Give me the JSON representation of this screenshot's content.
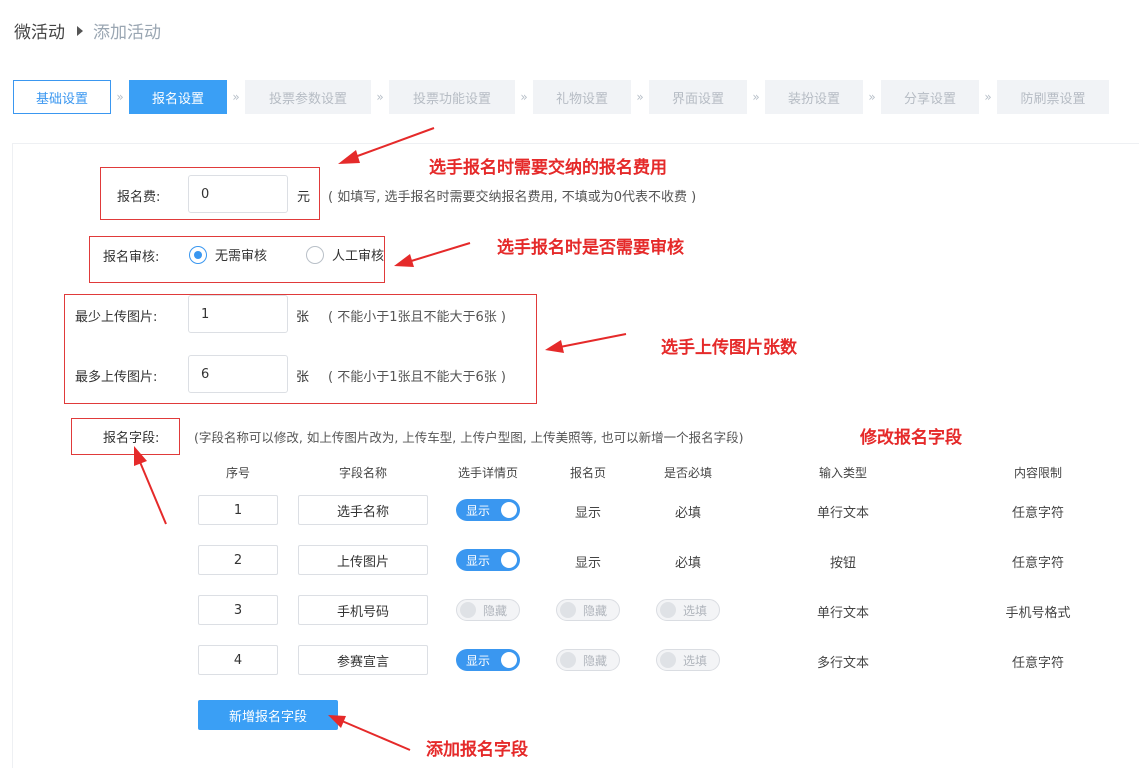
{
  "breadcrumb": {
    "root": "微活动",
    "current": "添加活动"
  },
  "steps": [
    "基础设置",
    "报名设置",
    "投票参数设置",
    "投票功能设置",
    "礼物设置",
    "界面设置",
    "装扮设置",
    "分享设置",
    "防刷票设置"
  ],
  "fee": {
    "label": "报名费:",
    "value": "0",
    "unit": "元",
    "hint": "( 如填写, 选手报名时需要交纳报名费用, 不填或为0代表不收费 )"
  },
  "review": {
    "label": "报名审核:",
    "options": [
      "无需审核",
      "人工审核"
    ],
    "selected": "无需审核"
  },
  "min_pics": {
    "label": "最少上传图片:",
    "value": "1",
    "unit": "张",
    "hint": "( 不能小于1张且不能大于6张 )"
  },
  "max_pics": {
    "label": "最多上传图片:",
    "value": "6",
    "unit": "张",
    "hint": "( 不能小于1张且不能大于6张 )"
  },
  "fields": {
    "label": "报名字段:",
    "hint": "(字段名称可以修改, 如上传图片改为, 上传车型, 上传户型图, 上传美照等, 也可以新增一个报名字段)",
    "headers": [
      "序号",
      "字段名称",
      "选手详情页",
      "报名页",
      "是否必填",
      "输入类型",
      "内容限制"
    ],
    "rows": [
      {
        "no": "1",
        "name": "选手名称",
        "detail": "显示",
        "detail_on": true,
        "signup": "显示",
        "signup_toggle": false,
        "required": "必填",
        "required_toggle": false,
        "type": "单行文本",
        "limit": "任意字符"
      },
      {
        "no": "2",
        "name": "上传图片",
        "detail": "显示",
        "detail_on": true,
        "signup": "显示",
        "signup_toggle": false,
        "required": "必填",
        "required_toggle": false,
        "type": "按钮",
        "limit": "任意字符"
      },
      {
        "no": "3",
        "name": "手机号码",
        "detail": "隐藏",
        "detail_on": false,
        "signup": "隐藏",
        "signup_toggle": true,
        "required": "选填",
        "required_toggle": true,
        "type": "单行文本",
        "limit": "手机号格式"
      },
      {
        "no": "4",
        "name": "参赛宣言",
        "detail": "显示",
        "detail_on": true,
        "signup": "隐藏",
        "signup_toggle": true,
        "required": "选填",
        "required_toggle": true,
        "type": "多行文本",
        "limit": "任意字符"
      }
    ],
    "add_button": "新增报名字段"
  },
  "annotations": {
    "fee": "选手报名时需要交纳的报名费用",
    "review": "选手报名时是否需要审核",
    "pics": "选手上传图片张数",
    "fields": "修改报名字段",
    "add": "添加报名字段"
  },
  "colors": {
    "accent": "#3a97f0",
    "annotation": "#e52a2a"
  }
}
